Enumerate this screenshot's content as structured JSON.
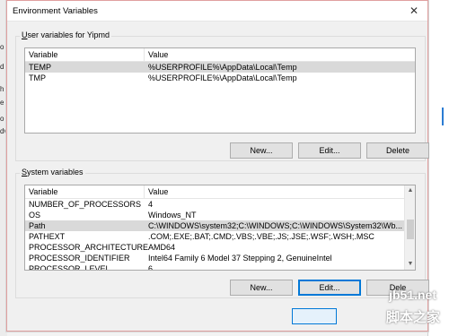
{
  "window": {
    "title": "Environment Variables",
    "close_glyph": "✕"
  },
  "user_group": {
    "label_prefix": "U",
    "label_rest": "ser variables for Yipmd",
    "columns": [
      "Variable",
      "Value"
    ],
    "rows": [
      {
        "variable": "TEMP",
        "value": "%USERPROFILE%\\AppData\\Local\\Temp",
        "selected": true
      },
      {
        "variable": "TMP",
        "value": "%USERPROFILE%\\AppData\\Local\\Temp",
        "selected": false
      }
    ],
    "buttons": {
      "new": "New...",
      "edit": "Edit...",
      "delete": "Delete"
    }
  },
  "system_group": {
    "label_prefix": "S",
    "label_rest": "ystem variables",
    "columns": [
      "Variable",
      "Value"
    ],
    "rows": [
      {
        "variable": "NUMBER_OF_PROCESSORS",
        "value": "4",
        "selected": false
      },
      {
        "variable": "OS",
        "value": "Windows_NT",
        "selected": false
      },
      {
        "variable": "Path",
        "value": "C:\\WINDOWS\\system32;C:\\WINDOWS;C:\\WINDOWS\\System32\\Wb...",
        "selected": true
      },
      {
        "variable": "PATHEXT",
        "value": ".COM;.EXE;.BAT;.CMD;.VBS;.VBE;.JS;.JSE;.WSF;.WSH;.MSC",
        "selected": false
      },
      {
        "variable": "PROCESSOR_ARCHITECTURE",
        "value": "AMD64",
        "selected": false
      },
      {
        "variable": "PROCESSOR_IDENTIFIER",
        "value": "Intel64 Family 6 Model 37 Stepping 2, GenuineIntel",
        "selected": false
      },
      {
        "variable": "PROCESSOR_LEVEL",
        "value": "6",
        "selected": false
      }
    ],
    "buttons": {
      "new": "New...",
      "edit": "Edit...",
      "delete": "Dele"
    }
  },
  "background": {
    "left_letters": [
      "o",
      "d",
      "h",
      "e",
      "o",
      "dv"
    ]
  },
  "watermark": {
    "url": "jb51.net",
    "cn": "脚本之家"
  }
}
